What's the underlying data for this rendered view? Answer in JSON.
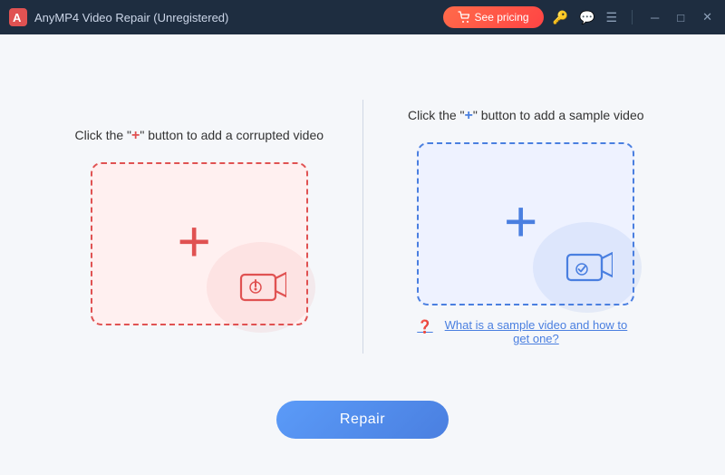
{
  "titleBar": {
    "title": "AnyMP4 Video Repair (Unregistered)",
    "pricingLabel": "See pricing",
    "logoIcon": "anymp4-logo-icon"
  },
  "leftPanel": {
    "titlePre": "Click the \"",
    "titlePlus": "+",
    "titlePost": "\" button to add a corrupted video",
    "dropZoneLabel": "add-corrupted-video-zone"
  },
  "rightPanel": {
    "titlePre": "Click the \"",
    "titlePlus": "+",
    "titlePost": "\" button to add a sample video",
    "helpText": "What is a sample video and how to get one?",
    "dropZoneLabel": "add-sample-video-zone"
  },
  "footer": {
    "repairLabel": "Repair"
  }
}
